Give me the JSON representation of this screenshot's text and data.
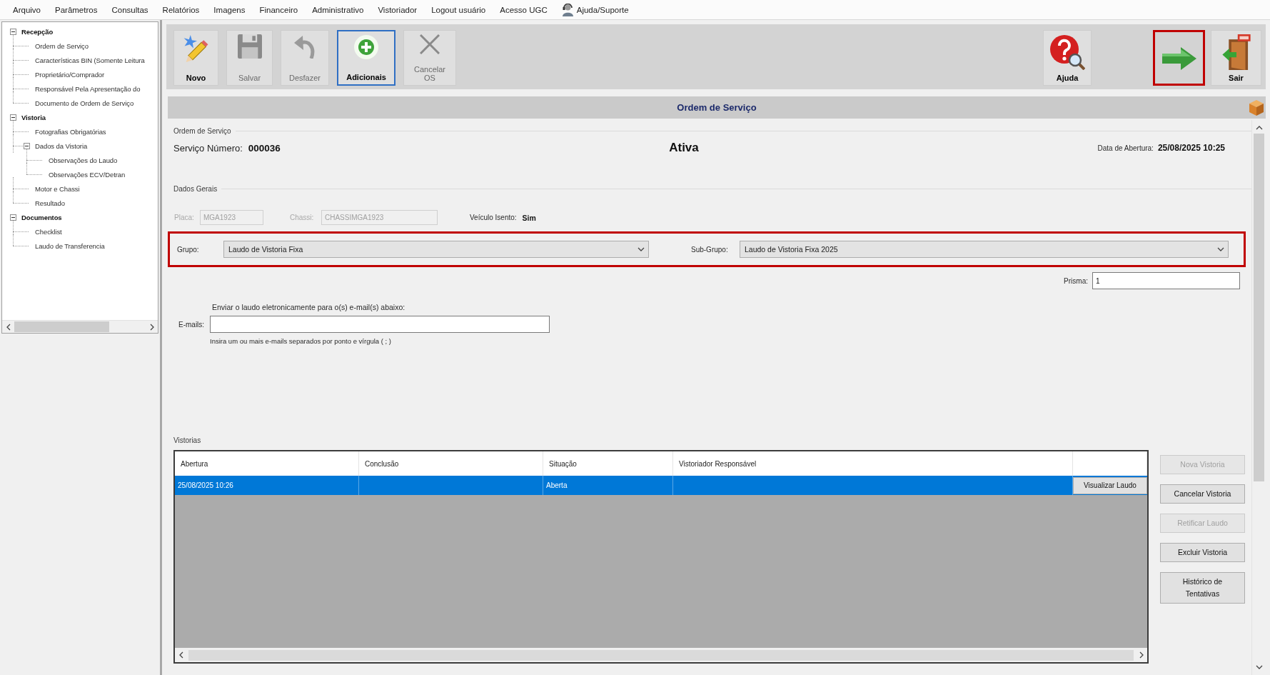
{
  "menu_bar": {
    "items": [
      "Arquivo",
      "Parâmetros",
      "Consultas",
      "Relatórios",
      "Imagens",
      "Financeiro",
      "Administrativo",
      "Vistoriador",
      "Logout usuário",
      "Acesso UGC"
    ],
    "support": "Ajuda/Suporte"
  },
  "tree": {
    "items": [
      {
        "label": "Recepção",
        "expanded": true,
        "children": [
          {
            "label": "Ordem de Serviço"
          },
          {
            "label": "Características BIN (Somente Leitura"
          },
          {
            "label": "Proprietário/Comprador"
          },
          {
            "label": "Responsável Pela Apresentação do"
          },
          {
            "label": "Documento de Ordem de Serviço"
          }
        ]
      },
      {
        "label": "Vistoria",
        "expanded": true,
        "children": [
          {
            "label": "Fotografias Obrigatórias"
          },
          {
            "label": "Dados da Vistoria",
            "expanded": true,
            "children": [
              {
                "label": "Observações do Laudo"
              },
              {
                "label": "Observações ECV/Detran"
              }
            ]
          },
          {
            "label": "Motor e Chassi"
          },
          {
            "label": "Resultado"
          }
        ]
      },
      {
        "label": "Documentos",
        "expanded": true,
        "children": [
          {
            "label": "Checklist"
          },
          {
            "label": "Laudo de Transferencia"
          }
        ]
      }
    ]
  },
  "toolbar": {
    "left": [
      {
        "kind": "new",
        "label": "Novo",
        "disabled": false,
        "focused": false
      },
      {
        "kind": "save",
        "label": "Salvar",
        "disabled": true,
        "focused": false
      },
      {
        "kind": "undo",
        "label": "Desfazer",
        "disabled": true,
        "focused": false
      },
      {
        "kind": "add",
        "label": "Adicionais",
        "disabled": false,
        "focused": true
      },
      {
        "kind": "cancel",
        "label": "Cancelar OS",
        "disabled": true,
        "focused": false
      }
    ],
    "right": [
      {
        "kind": "help",
        "label": "Ajuda",
        "highlighted": false
      },
      {
        "kind": "next",
        "highlighted": true
      },
      {
        "kind": "exit",
        "label": "Sair",
        "highlighted": false
      }
    ]
  },
  "title_bar": {
    "title": "Ordem de Serviço"
  },
  "order": {
    "legend": "Ordem de Serviço",
    "number_label": "Serviço Número:",
    "number": "000036",
    "status": "Ativa",
    "opened_label": "Data de Abertura:",
    "opened": "25/08/2025 10:25"
  },
  "general": {
    "legend": "Dados Gerais",
    "plate": {
      "label": "Placa:",
      "value": "MGA1923",
      "disabled": true
    },
    "chassis": {
      "label": "Chassi:",
      "value": "CHASSIMGA1923",
      "disabled": true
    },
    "exempt": {
      "label": "Veículo Isento:",
      "value": "Sim"
    },
    "group_row": {
      "highlighted": true,
      "group": {
        "label": "Grupo:",
        "value": "Laudo de Vistoria Fixa"
      },
      "subgroup": {
        "label": "Sub-Grupo:",
        "value": "Laudo de Vistoria Fixa 2025"
      }
    },
    "prism": {
      "label": "Prisma:",
      "value": "1"
    },
    "email": {
      "caption": "Enviar o laudo eletronicamente para o(s) e-mail(s) abaixo:",
      "label": "E-mails:",
      "note": "Insira um ou mais e-mails separados por ponto e vírgula ( ; )"
    }
  },
  "inspections": {
    "legend": "Vistorias",
    "columns": [
      "Abertura",
      "Conclusão",
      "Situação",
      "Vistoriador Responsável"
    ],
    "rows": [
      {
        "selected": true,
        "abertura": "25/08/2025 10:26",
        "situacao": "Aberta",
        "action": "Visualizar Laudo"
      }
    ],
    "buttons": [
      {
        "label": "Nova Vistoria",
        "disabled": true
      },
      {
        "label": "Cancelar Vistoria",
        "disabled": false
      },
      {
        "label": "Retificar Laudo",
        "disabled": true
      },
      {
        "label": "Excluir Vistoria",
        "disabled": false
      },
      {
        "label": "Histórico de Tentativas",
        "disabled": false
      }
    ]
  }
}
